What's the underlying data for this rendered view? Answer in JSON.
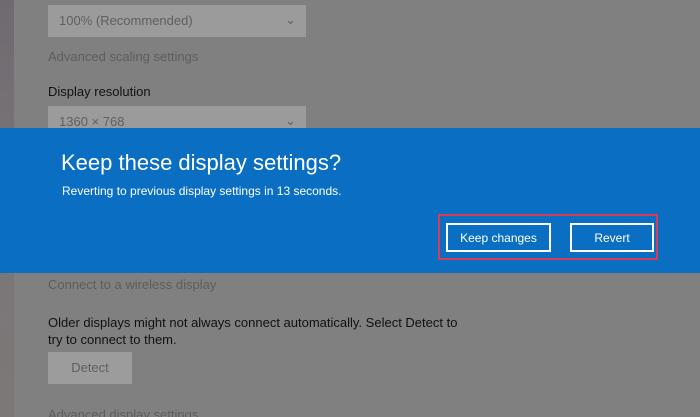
{
  "scale": {
    "selected_value": "100% (Recommended)",
    "dropdown_icon": "chevron-down-icon",
    "advanced_link": "Advanced scaling settings"
  },
  "resolution": {
    "label": "Display resolution",
    "selected_value": "1360 × 768"
  },
  "dialog": {
    "title": "Keep these display settings?",
    "message": "Reverting to previous display settings in 13 seconds.",
    "keep_label": "Keep changes",
    "revert_label": "Revert",
    "background_color": "#0a6fc2",
    "highlight_color": "#d83b55"
  },
  "wireless": {
    "link": "Connect to a wireless display",
    "description_line1": "Older displays might not always connect automatically. Select Detect to",
    "description_line2": "try to connect to them.",
    "detect_label": "Detect"
  },
  "advanced_display": {
    "link": "Advanced display settings"
  }
}
